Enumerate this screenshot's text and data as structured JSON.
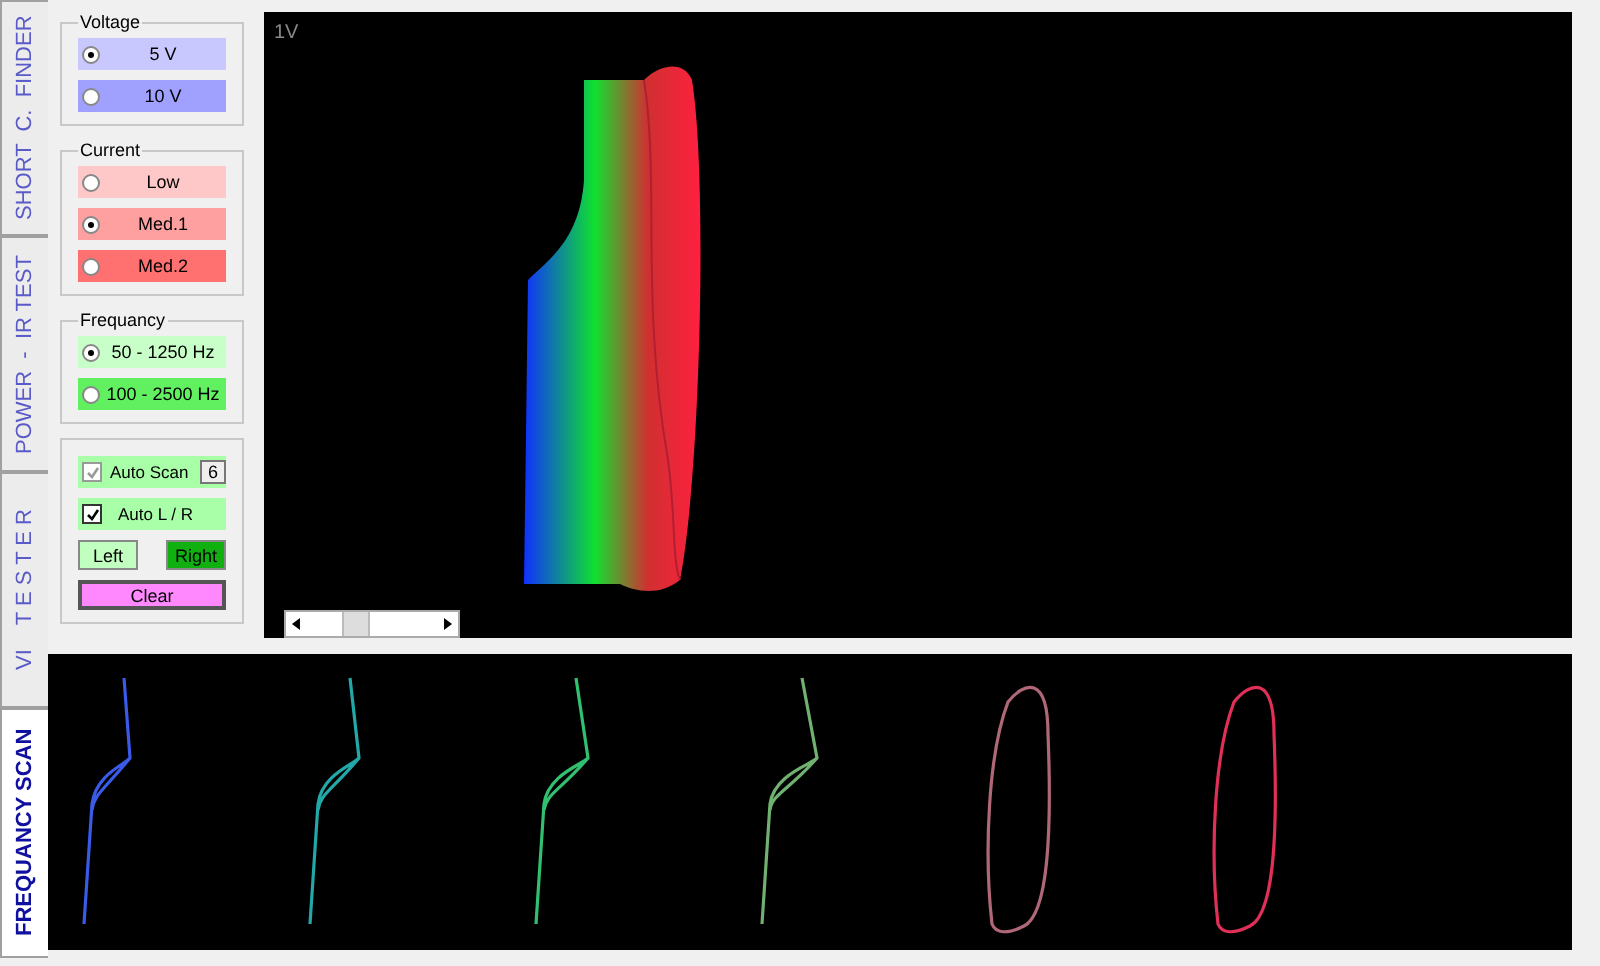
{
  "side_tabs": [
    {
      "label": "SHORT  C.  FINDER",
      "selected": false
    },
    {
      "label": "POWER  -  IR TEST",
      "selected": false
    },
    {
      "label": "VI    T E S T E R",
      "selected": false
    },
    {
      "label": "FREQUANCY SCAN",
      "selected": true
    }
  ],
  "groups": [
    {
      "title": "Voltage",
      "options": [
        {
          "label": "5 V",
          "selected": true,
          "color": "#c8c8ff"
        },
        {
          "label": "10 V",
          "selected": false,
          "color": "#a0a0ff"
        }
      ]
    },
    {
      "title": "Current",
      "options": [
        {
          "label": "Low",
          "selected": false,
          "color": "#ffc8c8"
        },
        {
          "label": "Med.1",
          "selected": true,
          "color": "#ffa0a0"
        },
        {
          "label": "Med.2",
          "selected": false,
          "color": "#ff7070"
        }
      ]
    },
    {
      "title": "Frequancy",
      "options": [
        {
          "label": "50 - 1250 Hz",
          "selected": true,
          "color": "#c8ffc8"
        },
        {
          "label": "100 - 2500 Hz",
          "selected": false,
          "color": "#60f060"
        }
      ]
    }
  ],
  "scan": {
    "auto_scan": {
      "label": "Auto Scan",
      "checked": true,
      "disabled": true,
      "count": "6"
    },
    "auto_lr": {
      "label": "Auto L / R",
      "checked": true
    },
    "sides": [
      {
        "label": "Left",
        "selected": false
      },
      {
        "label": "Right",
        "selected": true
      }
    ],
    "clear": "Clear"
  },
  "plot": {
    "scale_label": "1V"
  },
  "traces": [
    {
      "color": "#3a5ae8"
    },
    {
      "color": "#22a8a8"
    },
    {
      "color": "#30c070"
    },
    {
      "color": "#70b070"
    },
    {
      "color": "#b06878"
    },
    {
      "color": "#e03058"
    }
  ]
}
